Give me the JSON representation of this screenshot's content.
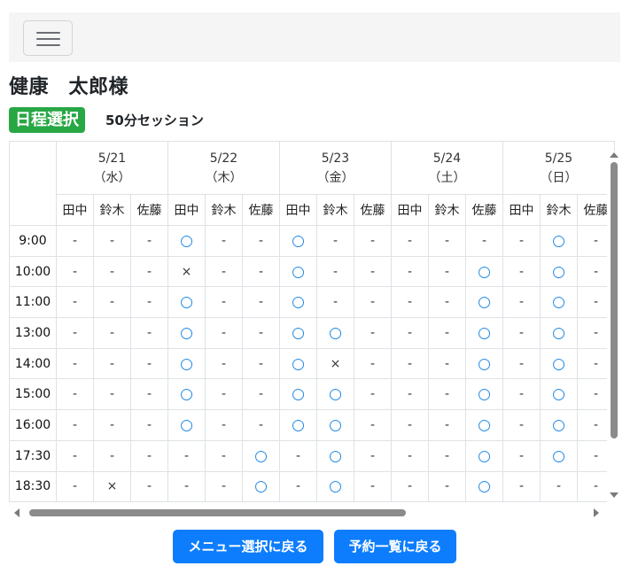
{
  "navbar": {
    "toggler_icon": "hamburger-menu-icon"
  },
  "user": {
    "name": "健康　太郎様"
  },
  "schedule": {
    "badge": "日程選択",
    "session": "50分セッション",
    "dates": [
      {
        "date": "5/21",
        "weekday": "（水）"
      },
      {
        "date": "5/22",
        "weekday": "（木）"
      },
      {
        "date": "5/23",
        "weekday": "（金）"
      },
      {
        "date": "5/24",
        "weekday": "（土）"
      },
      {
        "date": "5/25",
        "weekday": "（日）"
      }
    ],
    "staff": [
      "田中",
      "鈴木",
      "佐藤"
    ],
    "rows": [
      {
        "time": "9:00",
        "slots": [
          "-",
          "-",
          "-",
          "○",
          "-",
          "-",
          "○",
          "-",
          "-",
          "-",
          "-",
          "-",
          "-",
          "○",
          "-"
        ]
      },
      {
        "time": "10:00",
        "slots": [
          "-",
          "-",
          "-",
          "×",
          "-",
          "-",
          "○",
          "-",
          "-",
          "-",
          "-",
          "○",
          "-",
          "○",
          "-"
        ]
      },
      {
        "time": "11:00",
        "slots": [
          "-",
          "-",
          "-",
          "○",
          "-",
          "-",
          "○",
          "-",
          "-",
          "-",
          "-",
          "○",
          "-",
          "○",
          "-"
        ]
      },
      {
        "time": "13:00",
        "slots": [
          "-",
          "-",
          "-",
          "○",
          "-",
          "-",
          "○",
          "○",
          "-",
          "-",
          "-",
          "○",
          "-",
          "○",
          "-"
        ]
      },
      {
        "time": "14:00",
        "slots": [
          "-",
          "-",
          "-",
          "○",
          "-",
          "-",
          "○",
          "×",
          "-",
          "-",
          "-",
          "○",
          "-",
          "○",
          "-"
        ]
      },
      {
        "time": "15:00",
        "slots": [
          "-",
          "-",
          "-",
          "○",
          "-",
          "-",
          "○",
          "○",
          "-",
          "-",
          "-",
          "○",
          "-",
          "○",
          "-"
        ]
      },
      {
        "time": "16:00",
        "slots": [
          "-",
          "-",
          "-",
          "○",
          "-",
          "-",
          "○",
          "○",
          "-",
          "-",
          "-",
          "○",
          "-",
          "○",
          "-"
        ]
      },
      {
        "time": "17:30",
        "slots": [
          "-",
          "-",
          "-",
          "-",
          "-",
          "○",
          "-",
          "○",
          "-",
          "-",
          "-",
          "○",
          "-",
          "○",
          "-"
        ]
      },
      {
        "time": "18:30",
        "slots": [
          "-",
          "×",
          "-",
          "-",
          "-",
          "○",
          "-",
          "○",
          "-",
          "-",
          "-",
          "○",
          "-",
          "-",
          "-"
        ]
      }
    ]
  },
  "buttons": {
    "back_to_menu": "メニュー選択に戻る",
    "back_to_list": "予約一覧に戻る"
  },
  "colors": {
    "badge": "#28a745",
    "button": "#0d7dfd",
    "available": "#1e88e5"
  }
}
